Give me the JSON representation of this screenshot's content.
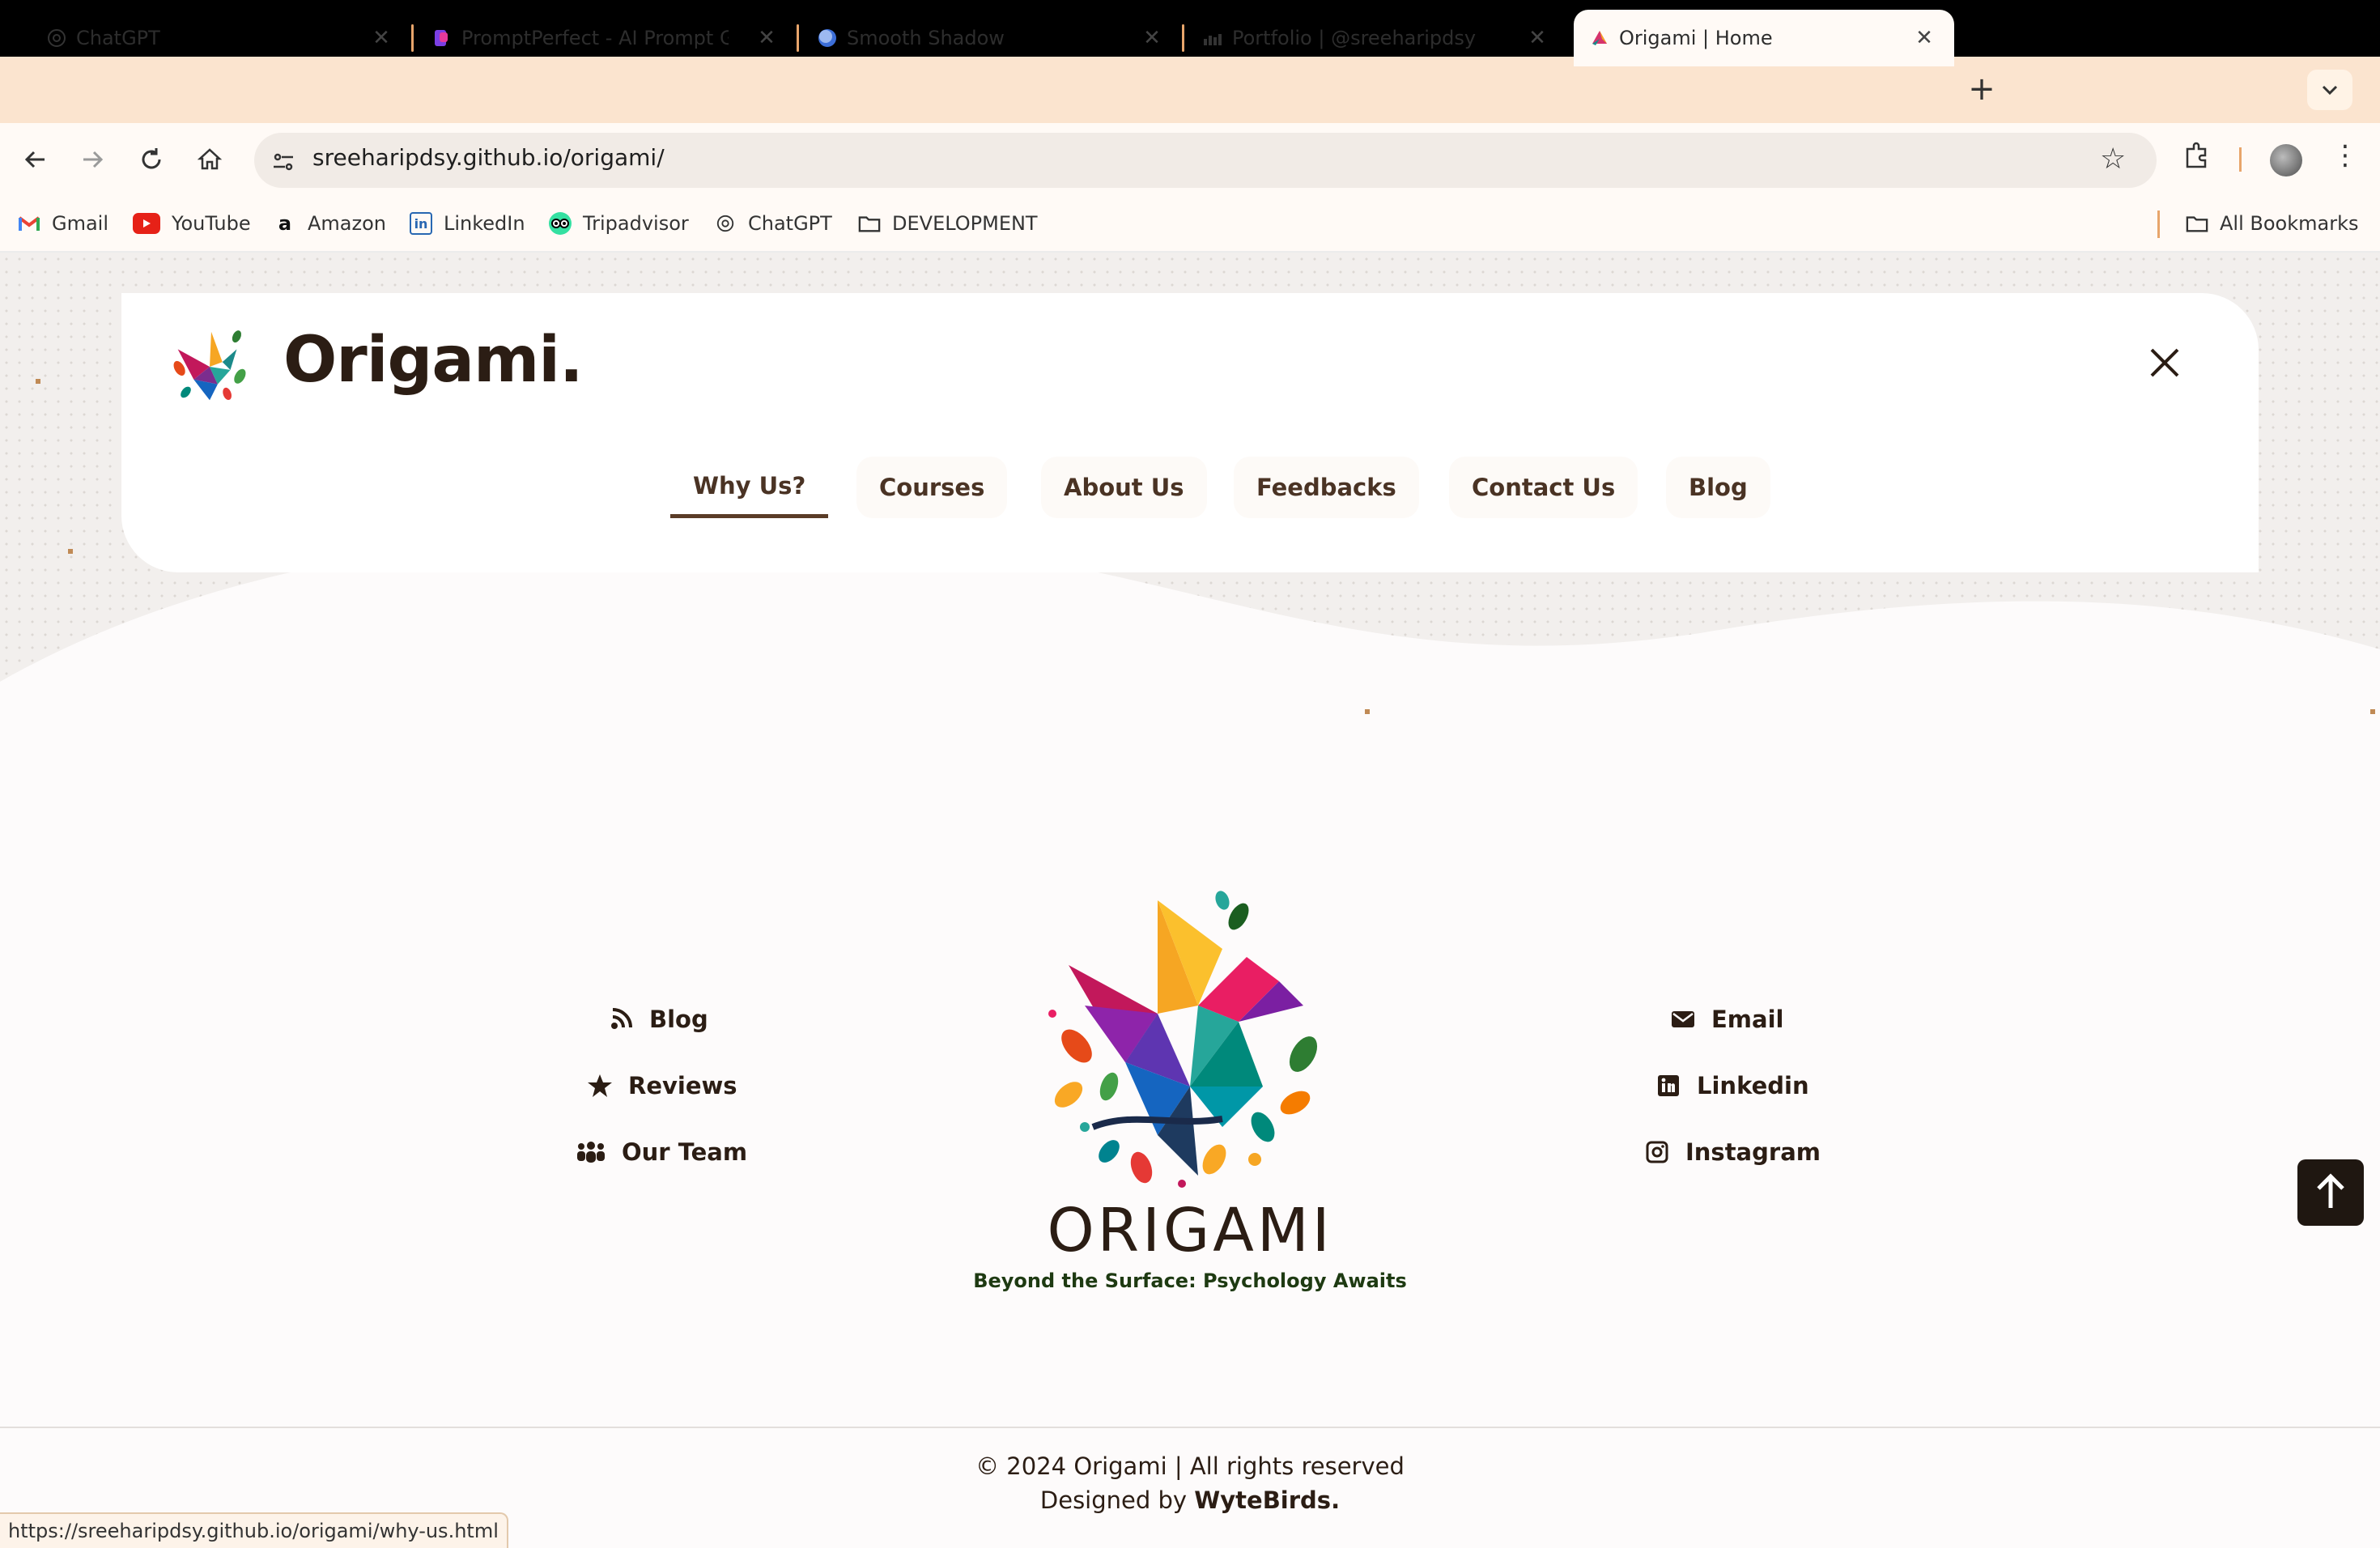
{
  "browser": {
    "tabs": [
      {
        "title": "ChatGPT",
        "icon": "chatgpt-icon"
      },
      {
        "title": "PromptPerfect - AI Prompt Generator",
        "icon": "promptperfect-icon"
      },
      {
        "title": "Smooth Shadow",
        "icon": "smooth-shadow-icon"
      },
      {
        "title": "Portfolio | @sreeharipdsy",
        "icon": "portfolio-icon"
      },
      {
        "title": "Origami | Home",
        "icon": "origami-icon",
        "active": true
      }
    ],
    "url": "sreeharipdsy.github.io/origami/",
    "bookmarks": [
      {
        "label": "Gmail",
        "icon": "gmail-icon"
      },
      {
        "label": "YouTube",
        "icon": "youtube-icon"
      },
      {
        "label": "Amazon",
        "icon": "amazon-icon"
      },
      {
        "label": "LinkedIn",
        "icon": "linkedin-icon"
      },
      {
        "label": "Tripadvisor",
        "icon": "tripadvisor-icon"
      },
      {
        "label": "ChatGPT",
        "icon": "chatgpt-icon"
      },
      {
        "label": "DEVELOPMENT",
        "icon": "folder-icon"
      }
    ],
    "all_bookmarks": "All Bookmarks",
    "status_url": "https://sreeharipdsy.github.io/origami/why-us.html"
  },
  "header": {
    "brand": "Origami.",
    "nav": [
      "Why Us?",
      "Courses",
      "About Us",
      "Feedbacks",
      "Contact Us",
      "Blog"
    ],
    "active_nav": "Why Us?"
  },
  "footer": {
    "title": "ORIGAMI",
    "tagline": "Beyond the Surface: Psychology Awaits",
    "left_links": [
      {
        "label": "Blog",
        "icon": "blog-icon"
      },
      {
        "label": "Reviews",
        "icon": "star-icon"
      },
      {
        "label": "Our Team",
        "icon": "team-icon"
      }
    ],
    "right_links": [
      {
        "label": "Email",
        "icon": "envelope-icon"
      },
      {
        "label": "Linkedin",
        "icon": "linkedin-icon"
      },
      {
        "label": "Instagram",
        "icon": "instagram-icon"
      }
    ],
    "copyright": "© 2024 Origami | All rights reserved",
    "designed_prefix": "Designed by ",
    "designed_by": "WyteBirds."
  },
  "colors": {
    "accent_dark": "#2b1d14",
    "tab_strip": "#fbe4cf",
    "tagline_green": "#1e3a12"
  }
}
